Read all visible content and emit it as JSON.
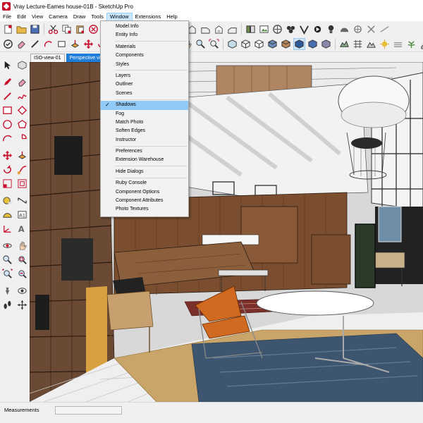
{
  "window": {
    "title": "Vray Lecture-Eames house-01B - SketchUp Pro"
  },
  "menubar": {
    "items": [
      "File",
      "Edit",
      "View",
      "Camera",
      "Draw",
      "Tools",
      "Window",
      "Extensions",
      "Help"
    ],
    "active": "Window"
  },
  "scene_tabs": [
    "ISO-view-01",
    "Perspective view-0"
  ],
  "window_menu": {
    "groups": [
      [
        "Model Info",
        "Entity Info"
      ],
      [
        "Materials",
        "Components",
        "Styles"
      ],
      [
        "Layers",
        "Outliner",
        "Scenes"
      ],
      [
        "Shadows",
        "Fog",
        "Match Photo",
        "Soften Edges",
        "Instructor"
      ],
      [
        "Preferences",
        "Extension Warehouse"
      ],
      [
        "Hide Dialogs"
      ],
      [
        "Ruby Console",
        "Component Options",
        "Component Attributes",
        "Photo Textures"
      ]
    ],
    "checked_item": "Shadows",
    "highlighted_item": "Shadows"
  },
  "statusbar": {
    "measurements_label": "Measurements",
    "measurements_value": ""
  },
  "colors": {
    "accent": "#1e7dd8",
    "menu_highlight": "#91c9f7",
    "brand": "#c8102e"
  },
  "icons": {
    "top_toolbar": [
      "new-icon",
      "open-icon",
      "save-icon",
      "cut-icon",
      "copy-icon",
      "paste-icon",
      "erase-icon",
      "undo-icon",
      "redo-icon",
      "print-icon",
      "model-info-icon",
      "iso-view-icon",
      "top-view-icon",
      "front-view-icon",
      "right-view-icon",
      "back-view-icon",
      "left-view-icon",
      "components-icon",
      "materials-icon",
      "warehouse-icon",
      "extension-icon",
      "vray-icon"
    ],
    "second_toolbar": [
      "select-icon",
      "eraser-icon",
      "line-icon",
      "arc-icon",
      "rectangle-icon",
      "pushpull-icon",
      "move-icon",
      "rotate-icon",
      "scale-icon",
      "offset-icon",
      "tape-icon",
      "text-icon",
      "orbit-icon",
      "pan-icon",
      "zoom-icon",
      "zoom-extents-icon",
      "xray-icon",
      "wireframe-icon",
      "hidden-line-icon",
      "shaded-icon",
      "textured-icon",
      "monochrome-icon",
      "section-icon",
      "sandbox-icon"
    ]
  }
}
